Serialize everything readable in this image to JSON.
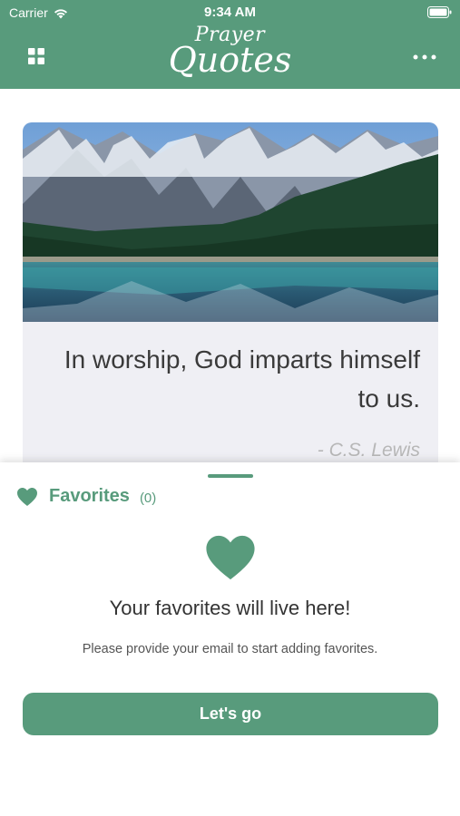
{
  "status_bar": {
    "carrier": "Carrier",
    "time": "9:34 AM"
  },
  "header": {
    "title_top": "Prayer",
    "title_main": "Quotes"
  },
  "quote": {
    "text": "In worship, God imparts himself to us.",
    "author": "- C.S. Lewis"
  },
  "favorites": {
    "title": "Favorites",
    "count": "(0)",
    "empty_title": "Your favorites will live here!",
    "empty_subtitle": "Please provide your email to start adding favorites.",
    "button_label": "Let's go"
  },
  "colors": {
    "accent": "#589b7c",
    "card_bg": "#efeff4"
  }
}
